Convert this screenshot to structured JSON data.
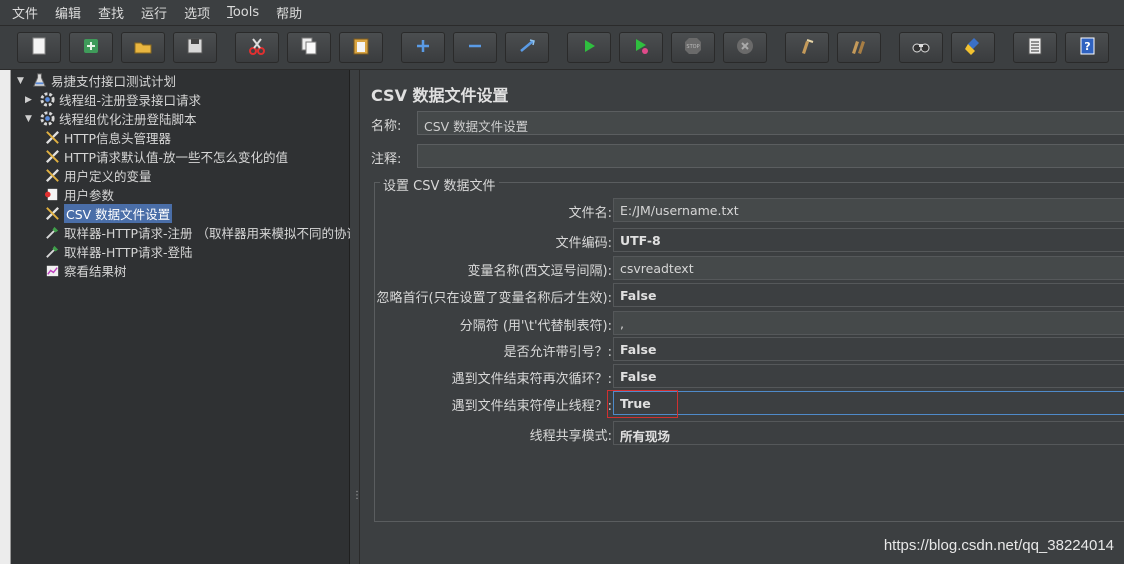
{
  "menu": [
    {
      "label": "文件"
    },
    {
      "label": "编辑"
    },
    {
      "label": "查找"
    },
    {
      "label": "运行"
    },
    {
      "label": "选项"
    },
    {
      "label": "Tools"
    },
    {
      "label": "帮助"
    }
  ],
  "toolbar": [
    {
      "name": "new-icon"
    },
    {
      "name": "templates-icon"
    },
    {
      "name": "open-icon"
    },
    {
      "name": "save-icon"
    },
    {
      "name": "cut-icon"
    },
    {
      "name": "copy-icon"
    },
    {
      "name": "paste-icon"
    },
    {
      "name": "expand-icon"
    },
    {
      "name": "collapse-icon"
    },
    {
      "name": "toggle-icon"
    },
    {
      "name": "start-icon"
    },
    {
      "name": "start-no-pause-icon"
    },
    {
      "name": "stop-icon"
    },
    {
      "name": "shutdown-icon"
    },
    {
      "name": "clear-icon"
    },
    {
      "name": "clear-all-icon"
    },
    {
      "name": "search-icon"
    },
    {
      "name": "reset-search-icon"
    },
    {
      "name": "function-helper-icon"
    },
    {
      "name": "help-icon"
    }
  ],
  "tree": [
    {
      "label": "易捷支付接口测试计划",
      "arrow": "▼",
      "icon": "test-plan-icon",
      "level": 0
    },
    {
      "label": "线程组-注册登录接口请求",
      "arrow": "▶",
      "icon": "thread-group-icon",
      "level": 1
    },
    {
      "label": "线程组优化注册登陆脚本",
      "arrow": "▼",
      "icon": "thread-group-icon",
      "level": 1
    },
    {
      "label": "HTTP信息头管理器",
      "arrow": "",
      "icon": "config-wrench-icon",
      "level": 2
    },
    {
      "label": "HTTP请求默认值-放一些不怎么变化的值",
      "arrow": "",
      "icon": "config-wrench-icon",
      "level": 2
    },
    {
      "label": "用户定义的变量",
      "arrow": "",
      "icon": "config-wrench-icon",
      "level": 2
    },
    {
      "label": "用户参数",
      "arrow": "",
      "icon": "preprocessor-icon",
      "level": 2
    },
    {
      "label": "CSV 数据文件设置",
      "arrow": "",
      "icon": "config-wrench-icon",
      "level": 2,
      "selected": true
    },
    {
      "label": "取样器-HTTP请求-注册 （取样器用来模拟不同的协议",
      "arrow": "",
      "icon": "sampler-pipette-icon",
      "level": 2
    },
    {
      "label": "取样器-HTTP请求-登陆",
      "arrow": "",
      "icon": "sampler-pipette-icon",
      "level": 2
    },
    {
      "label": "察看结果树",
      "arrow": "",
      "icon": "listener-chart-icon",
      "level": 2
    }
  ],
  "panel": {
    "title": "CSV 数据文件设置",
    "name_label": "名称:",
    "name_value": "CSV 数据文件设置",
    "comment_label": "注释:",
    "comment_value": "",
    "group_title": "设置 CSV 数据文件",
    "rows": [
      {
        "label": "文件名:",
        "value": "E:/JM/username.txt",
        "bold": false
      },
      {
        "label": "文件编码:",
        "value": "UTF-8",
        "bold": true
      },
      {
        "label": "变量名称(西文逗号间隔):",
        "value": "csvreadtext",
        "bold": false
      },
      {
        "label": "忽略首行(只在设置了变量名称后才生效):",
        "value": "False",
        "bold": true
      },
      {
        "label": "分隔符 (用'\\t'代替制表符):",
        "value": ",",
        "bold": false
      },
      {
        "label": "是否允许带引号？:",
        "value": "False",
        "bold": true
      },
      {
        "label": "遇到文件结束符再次循环？:",
        "value": "False",
        "bold": true
      },
      {
        "label": "遇到文件结束符停止线程？:",
        "value": "True",
        "bold": true,
        "focused": true
      },
      {
        "label": "线程共享模式:",
        "value": "所有现场",
        "bold": true
      }
    ]
  },
  "watermark": "https://blog.csdn.net/qq_38224014"
}
